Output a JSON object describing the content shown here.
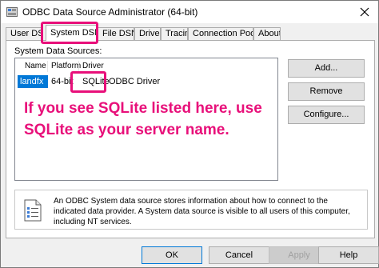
{
  "window": {
    "title": "ODBC Data Source Administrator (64-bit)"
  },
  "tabs": [
    {
      "label": "User DSN"
    },
    {
      "label": "System DSN",
      "active": true
    },
    {
      "label": "File DSN"
    },
    {
      "label": "Drivers"
    },
    {
      "label": "Tracing"
    },
    {
      "label": "Connection Pooling"
    },
    {
      "label": "About"
    }
  ],
  "system_data_sources": {
    "label": "System Data Sources:",
    "columns": [
      "Name",
      "Platform",
      "Driver"
    ],
    "rows": [
      {
        "name": "landfx",
        "platform": "64-bit",
        "driver_highlight": "SQLite",
        "driver_rest": "ODBC Driver"
      }
    ]
  },
  "annotation": "If you see SQLite listed here, use SQLite as your server name.",
  "buttons": {
    "add": "Add...",
    "remove": "Remove",
    "configure": "Configure..."
  },
  "info": "An ODBC System data source stores information about how to connect to the indicated data provider. A System data source is visible to all users of this computer, including NT services.",
  "footer": {
    "ok": "OK",
    "cancel": "Cancel",
    "apply": "Apply",
    "help": "Help"
  },
  "colors": {
    "highlight": "#e8107a",
    "selection": "#0078d7"
  }
}
